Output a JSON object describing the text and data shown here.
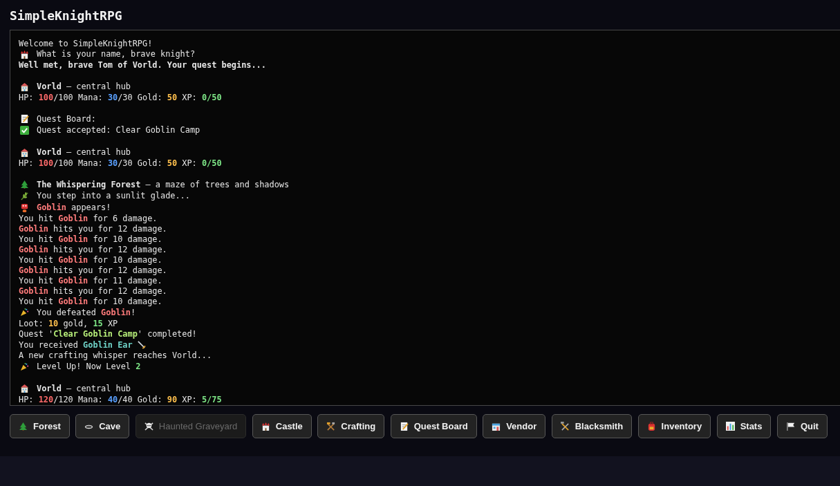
{
  "title": "SimpleKnightRPG",
  "log": [
    {
      "kind": "plain",
      "segments": [
        {
          "text": "Welcome to SimpleKnightRPG!",
          "kind": "normal"
        }
      ]
    },
    {
      "kind": "castle",
      "segments": [
        {
          "text": "What is your name, brave knight?",
          "kind": "normal"
        }
      ]
    },
    {
      "kind": "plain",
      "segments": [
        {
          "text": "Well met, brave Tom of Vorld. Your quest begins...",
          "kind": "strong"
        }
      ]
    },
    {
      "kind": "blank"
    },
    {
      "kind": "hub",
      "segments": [
        {
          "text": "Vorld",
          "kind": "strong"
        },
        {
          "text": " — central hub",
          "kind": "normal"
        }
      ]
    },
    {
      "kind": "plain",
      "segments": [
        {
          "text": "HP: ",
          "kind": "normal"
        },
        {
          "text": "100",
          "kind": "hp"
        },
        {
          "text": "/100 Mana: ",
          "kind": "normal"
        },
        {
          "text": "30",
          "kind": "mana"
        },
        {
          "text": "/30 Gold: ",
          "kind": "normal"
        },
        {
          "text": "50",
          "kind": "gold"
        },
        {
          "text": " XP: ",
          "kind": "normal"
        },
        {
          "text": "0/50",
          "kind": "xp"
        }
      ]
    },
    {
      "kind": "blank"
    },
    {
      "kind": "memo",
      "segments": [
        {
          "text": "Quest Board:",
          "kind": "normal"
        }
      ]
    },
    {
      "kind": "check",
      "segments": [
        {
          "text": "Quest accepted: Clear Goblin Camp",
          "kind": "normal"
        }
      ]
    },
    {
      "kind": "blank"
    },
    {
      "kind": "hub",
      "segments": [
        {
          "text": "Vorld",
          "kind": "strong"
        },
        {
          "text": " — central hub",
          "kind": "normal"
        }
      ]
    },
    {
      "kind": "plain",
      "segments": [
        {
          "text": "HP: ",
          "kind": "normal"
        },
        {
          "text": "100",
          "kind": "hp"
        },
        {
          "text": "/100 Mana: ",
          "kind": "normal"
        },
        {
          "text": "30",
          "kind": "mana"
        },
        {
          "text": "/30 Gold: ",
          "kind": "normal"
        },
        {
          "text": "50",
          "kind": "gold"
        },
        {
          "text": " XP: ",
          "kind": "normal"
        },
        {
          "text": "0/50",
          "kind": "xp"
        }
      ]
    },
    {
      "kind": "blank"
    },
    {
      "kind": "tree",
      "segments": [
        {
          "text": "The Whispering Forest",
          "kind": "strong"
        },
        {
          "text": " — a maze of trees and shadows",
          "kind": "normal"
        }
      ]
    },
    {
      "kind": "leaf",
      "segments": [
        {
          "text": "You step into a sunlit glade...",
          "kind": "normal"
        }
      ]
    },
    {
      "kind": "goblin",
      "segments": [
        {
          "text": "Goblin",
          "kind": "enemy"
        },
        {
          "text": " appears!",
          "kind": "normal"
        }
      ]
    },
    {
      "kind": "plain",
      "segments": [
        {
          "text": "You hit ",
          "kind": "normal"
        },
        {
          "text": "Goblin",
          "kind": "enemy"
        },
        {
          "text": " for 6 damage.",
          "kind": "normal"
        }
      ]
    },
    {
      "kind": "plain",
      "segments": [
        {
          "text": "Goblin",
          "kind": "enemy"
        },
        {
          "text": " hits you for 12 damage.",
          "kind": "normal"
        }
      ]
    },
    {
      "kind": "plain",
      "segments": [
        {
          "text": "You hit ",
          "kind": "normal"
        },
        {
          "text": "Goblin",
          "kind": "enemy"
        },
        {
          "text": " for 10 damage.",
          "kind": "normal"
        }
      ]
    },
    {
      "kind": "plain",
      "segments": [
        {
          "text": "Goblin",
          "kind": "enemy"
        },
        {
          "text": " hits you for 12 damage.",
          "kind": "normal"
        }
      ]
    },
    {
      "kind": "plain",
      "segments": [
        {
          "text": "You hit ",
          "kind": "normal"
        },
        {
          "text": "Goblin",
          "kind": "enemy"
        },
        {
          "text": " for 10 damage.",
          "kind": "normal"
        }
      ]
    },
    {
      "kind": "plain",
      "segments": [
        {
          "text": "Goblin",
          "kind": "enemy"
        },
        {
          "text": " hits you for 12 damage.",
          "kind": "normal"
        }
      ]
    },
    {
      "kind": "plain",
      "segments": [
        {
          "text": "You hit ",
          "kind": "normal"
        },
        {
          "text": "Goblin",
          "kind": "enemy"
        },
        {
          "text": " for 11 damage.",
          "kind": "normal"
        }
      ]
    },
    {
      "kind": "plain",
      "segments": [
        {
          "text": "Goblin",
          "kind": "enemy"
        },
        {
          "text": " hits you for 12 damage.",
          "kind": "normal"
        }
      ]
    },
    {
      "kind": "plain",
      "segments": [
        {
          "text": "You hit ",
          "kind": "normal"
        },
        {
          "text": "Goblin",
          "kind": "enemy"
        },
        {
          "text": " for 10 damage.",
          "kind": "normal"
        }
      ]
    },
    {
      "kind": "party",
      "segments": [
        {
          "text": "You defeated ",
          "kind": "normal"
        },
        {
          "text": "Goblin",
          "kind": "enemy"
        },
        {
          "text": "!",
          "kind": "normal"
        }
      ]
    },
    {
      "kind": "plain",
      "segments": [
        {
          "text": "Loot: ",
          "kind": "normal"
        },
        {
          "text": "10",
          "kind": "gold"
        },
        {
          "text": " gold, ",
          "kind": "normal"
        },
        {
          "text": "15",
          "kind": "xp"
        },
        {
          "text": " XP",
          "kind": "normal"
        }
      ]
    },
    {
      "kind": "plain",
      "segments": [
        {
          "text": "Quest '",
          "kind": "normal"
        },
        {
          "text": "Clear Goblin Camp",
          "kind": "quest"
        },
        {
          "text": "' completed!",
          "kind": "normal"
        }
      ]
    },
    {
      "kind": "wand",
      "segments": [
        {
          "text": "You received ",
          "kind": "normal"
        },
        {
          "text": "Goblin Ear",
          "kind": "item"
        }
      ]
    },
    {
      "kind": "plain",
      "segments": [
        {
          "text": "A new crafting whisper reaches Vorld...",
          "kind": "normal"
        }
      ]
    },
    {
      "kind": "party",
      "segments": [
        {
          "text": "Level Up! Now Level ",
          "kind": "normal"
        },
        {
          "text": "2",
          "kind": "xp"
        }
      ]
    },
    {
      "kind": "blank"
    },
    {
      "kind": "hub",
      "segments": [
        {
          "text": "Vorld",
          "kind": "strong"
        },
        {
          "text": " — central hub",
          "kind": "normal"
        }
      ]
    },
    {
      "kind": "plain",
      "segments": [
        {
          "text": "HP: ",
          "kind": "normal"
        },
        {
          "text": "120",
          "kind": "hp"
        },
        {
          "text": "/120 Mana: ",
          "kind": "normal"
        },
        {
          "text": "40",
          "kind": "mana"
        },
        {
          "text": "/40 Gold: ",
          "kind": "normal"
        },
        {
          "text": "90",
          "kind": "gold"
        },
        {
          "text": " XP: ",
          "kind": "normal"
        },
        {
          "text": "5/75",
          "kind": "xp"
        }
      ]
    }
  ],
  "buttons": [
    {
      "label": "Forest",
      "kind": "tree",
      "disabled": false
    },
    {
      "label": "Cave",
      "kind": "cave",
      "disabled": false
    },
    {
      "label": "Haunted Graveyard",
      "kind": "skull",
      "disabled": true
    },
    {
      "label": "Castle",
      "kind": "castle",
      "disabled": false
    },
    {
      "label": "Crafting",
      "kind": "tools",
      "disabled": false
    },
    {
      "label": "Quest Board",
      "kind": "memo",
      "disabled": false
    },
    {
      "label": "Vendor",
      "kind": "shop",
      "disabled": false
    },
    {
      "label": "Blacksmith",
      "kind": "hammer",
      "disabled": false
    },
    {
      "label": "Inventory",
      "kind": "bag",
      "disabled": false
    },
    {
      "label": "Stats",
      "kind": "chart",
      "disabled": false
    },
    {
      "label": "Quit",
      "kind": "flag",
      "disabled": false
    }
  ]
}
